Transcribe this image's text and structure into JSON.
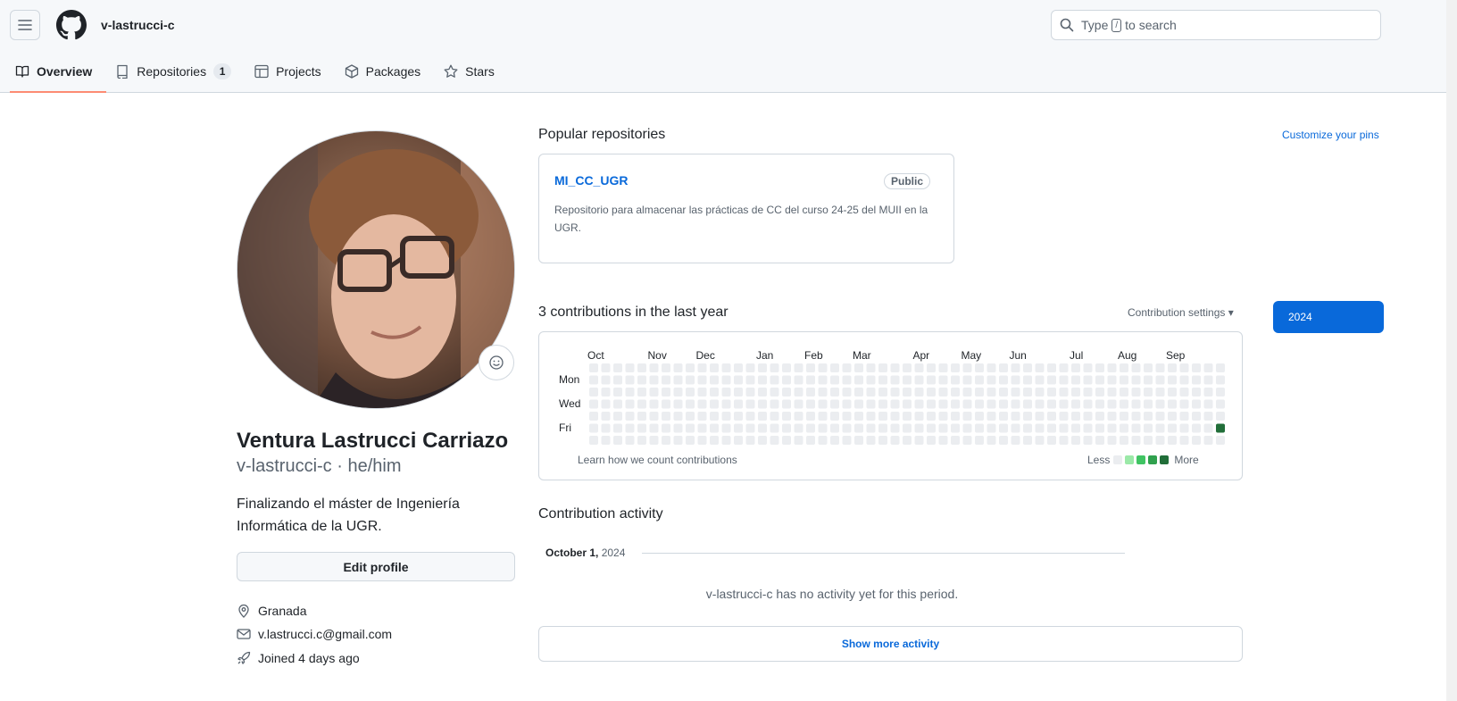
{
  "header": {
    "username_crumb": "v-lastrucci-c",
    "search": {
      "prefix": "Type",
      "key": "/",
      "suffix": "to search"
    }
  },
  "tabs": [
    {
      "label": "Overview",
      "icon": "book-icon",
      "active": true
    },
    {
      "label": "Repositories",
      "icon": "repo-icon",
      "count": "1"
    },
    {
      "label": "Projects",
      "icon": "table-icon"
    },
    {
      "label": "Packages",
      "icon": "package-icon"
    },
    {
      "label": "Stars",
      "icon": "star-icon"
    }
  ],
  "profile": {
    "name": "Ventura Lastrucci Carriazo",
    "login_pronouns": "v-lastrucci-c · he/him",
    "bio": "Finalizando el máster de Ingeniería Informática de la UGR.",
    "edit_label": "Edit profile",
    "location": "Granada",
    "email": "v.lastrucci.c@gmail.com",
    "joined": "Joined 4 days ago"
  },
  "popular": {
    "title": "Popular repositories",
    "customize_label": "Customize your pins",
    "repos": [
      {
        "name": "MI_CC_UGR",
        "visibility": "Public",
        "description": "Repositorio para almacenar las prácticas de CC del curso 24-25 del MUII en la UGR."
      }
    ]
  },
  "contributions": {
    "title": "3 contributions in the last year",
    "settings_label": "Contribution settings",
    "year_button": "2024",
    "months": [
      "Oct",
      "Nov",
      "Dec",
      "Jan",
      "Feb",
      "Mar",
      "Apr",
      "May",
      "Jun",
      "Jul",
      "Aug",
      "Sep"
    ],
    "days": [
      "Mon",
      "Wed",
      "Fri"
    ],
    "weeks": 53,
    "active_cell": {
      "week": 52,
      "day": 5,
      "level": 4
    },
    "learn_label": "Learn how we count contributions",
    "legend_less": "Less",
    "legend_more": "More",
    "colors": {
      "empty": "#ebedf0",
      "l1": "#9be9a8",
      "l2": "#40c463",
      "l3": "#30a14e",
      "l4": "#216e39"
    }
  },
  "activity": {
    "title": "Contribution activity",
    "date_label": "October 1,",
    "date_year": "2024",
    "empty_message": "v-lastrucci-c has no activity yet for this period.",
    "show_more_label": "Show more activity"
  }
}
